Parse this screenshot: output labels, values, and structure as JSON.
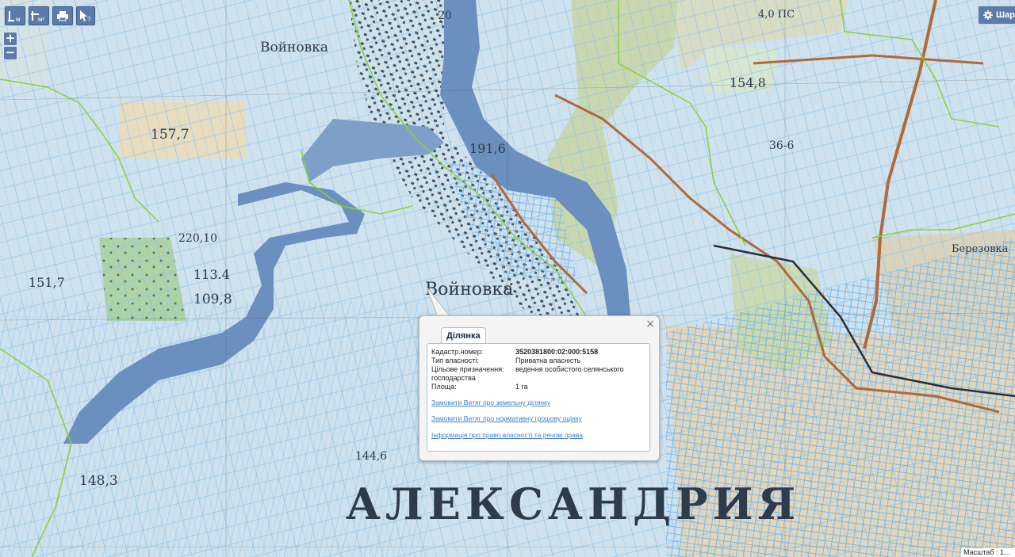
{
  "toolbar": {
    "measure_line_label": "м",
    "measure_area_label": "м²",
    "settings_label": "Шар"
  },
  "zoom": {
    "in": "+",
    "out": "−"
  },
  "map_labels": {
    "village_top": "Войновка",
    "height_157": "157,7",
    "height_191": "191,6",
    "height_220": "220,10",
    "height_154": "154,8",
    "code_113": "113.4",
    "code_109": "109,8",
    "height_151": "151,7",
    "village_mid": "Войновка",
    "berezovka": "Березовка",
    "city": "АЛЕКСАНДРИЯ",
    "height_144": "144,6",
    "height_148": "148,3",
    "forty_ps": "4,0 ПС",
    "twenty": "20",
    "thirty_six": "36-6"
  },
  "popup": {
    "tab_title": "Ділянка",
    "close_symbol": "×",
    "rows": [
      {
        "label": "Кадастр.номер:",
        "value": "3520381800:02:000:5158"
      },
      {
        "label": "Тип власності:",
        "value": "Приватна власність"
      },
      {
        "label": "Цільове призначення:",
        "value": "ведення особистого селянського"
      },
      {
        "label": "",
        "value": "господарства"
      },
      {
        "label": "Площа:",
        "value": "1 га"
      }
    ],
    "links": [
      "Замовити Витяг про земельну ділянку",
      "Замовити Витяг про нормативну грошову оцінку",
      "Інформація про право власності та речові права"
    ]
  },
  "scale": {
    "label": "Масштаб : 1..."
  },
  "colors": {
    "parcel_line": "#7ab8e8",
    "boundary_line": "#8ccf3a",
    "river": "#5b7fb0",
    "road": "#b06a3a",
    "button": "#5b7ba8",
    "link": "#3f7fc8"
  }
}
